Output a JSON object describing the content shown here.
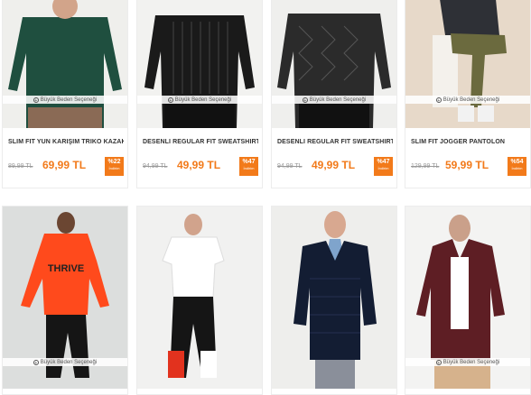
{
  "size_note": "Büyük Beden Seçeneği",
  "products": [
    {
      "name": "SLİM FİT YÜN KARIŞIM TRİKO KAZAK",
      "old_price": "89,99 TL",
      "price": "69,99 TL",
      "discount": "%22",
      "discount_label": "İndirim"
    },
    {
      "name": "DESENLİ REGULAR FİT SWEATSHİRT",
      "old_price": "94,99 TL",
      "price": "49,99 TL",
      "discount": "%47",
      "discount_label": "İndirim"
    },
    {
      "name": "DESENLİ REGULAR FİT SWEATSHİRT",
      "old_price": "94,99 TL",
      "price": "49,99 TL",
      "discount": "%47",
      "discount_label": "İndirim"
    },
    {
      "name": "SLİM FİT JOGGER PANTOLON",
      "old_price": "129,99 TL",
      "price": "59,99 TL",
      "discount": "%54",
      "discount_label": "İndirim"
    }
  ],
  "bottom_products": [
    {
      "print": "THRIVE"
    },
    {},
    {},
    {}
  ],
  "colors": {
    "accent": "#f27a1a"
  }
}
